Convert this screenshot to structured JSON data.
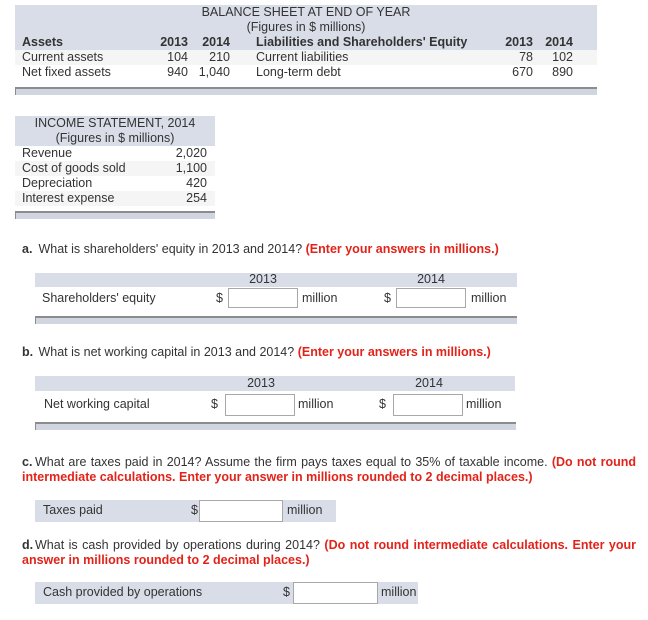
{
  "balance_sheet": {
    "title": "BALANCE SHEET AT END OF YEAR",
    "subtitle": "(Figures in $ millions)",
    "assets_header": "Assets",
    "liab_header": "Liabilities and Shareholders' Equity",
    "year1": "2013",
    "year2": "2014",
    "assets": [
      {
        "label": "Current assets",
        "v2013": "104",
        "v2014": "210"
      },
      {
        "label": "Net fixed assets",
        "v2013": "940",
        "v2014": "1,040"
      }
    ],
    "liabilities": [
      {
        "label": "Current liabilities",
        "v2013": "78",
        "v2014": "102"
      },
      {
        "label": "Long-term debt",
        "v2013": "670",
        "v2014": "890"
      }
    ]
  },
  "income_statement": {
    "title": "INCOME STATEMENT, 2014",
    "subtitle": "(Figures in $ millions)",
    "rows": [
      {
        "label": "Revenue",
        "value": "2,020"
      },
      {
        "label": "Cost of goods sold",
        "value": "1,100"
      },
      {
        "label": "Depreciation",
        "value": "420"
      },
      {
        "label": "Interest expense",
        "value": "254"
      }
    ]
  },
  "questions": {
    "a": {
      "letter": "a.",
      "text": "What is shareholders' equity in 2013 and 2014?",
      "instruction": "(Enter your answers in millions.)",
      "row_label": "Shareholders' equity",
      "col1": "2013",
      "col2": "2014",
      "currency": "$",
      "unit": "million",
      "value_2013": "",
      "value_2014": ""
    },
    "b": {
      "letter": "b.",
      "text": "What is net working capital in 2013 and 2014?",
      "instruction": "(Enter your answers in millions.)",
      "row_label": "Net working capital",
      "col1": "2013",
      "col2": "2014",
      "currency": "$",
      "unit": "million",
      "value_2013": "",
      "value_2014": ""
    },
    "c": {
      "letter": "c.",
      "text": "What are taxes paid in 2014? Assume the firm pays taxes equal to 35% of taxable income.",
      "instruction": "(Do not round intermediate calculations. Enter your answer in millions rounded to 2 decimal places.)",
      "row_label": "Taxes paid",
      "currency": "$",
      "unit": "million",
      "value": ""
    },
    "d": {
      "letter": "d.",
      "text": "What is cash provided by operations during 2014?",
      "instruction": "(Do not round intermediate calculations. Enter your answer in millions rounded to 2 decimal places.)",
      "row_label": "Cash provided by operations",
      "currency": "$",
      "unit": "million",
      "value": ""
    }
  },
  "colors": {
    "band": "#d8dde8",
    "instruction_red": "#e2231a"
  }
}
